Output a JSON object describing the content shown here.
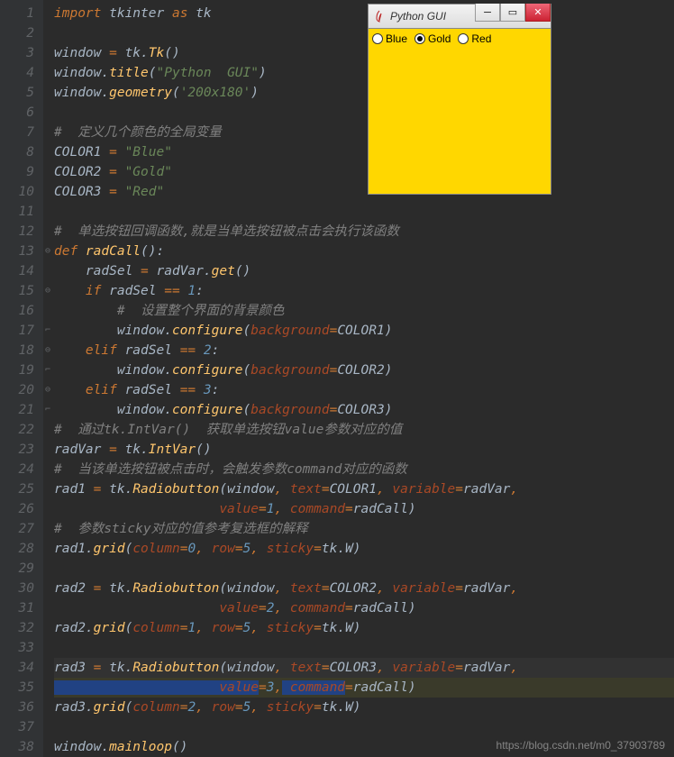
{
  "gutter": [
    "1",
    "2",
    "3",
    "4",
    "5",
    "6",
    "7",
    "8",
    "9",
    "10",
    "11",
    "12",
    "13",
    "14",
    "15",
    "16",
    "17",
    "18",
    "19",
    "20",
    "21",
    "22",
    "23",
    "24",
    "25",
    "26",
    "27",
    "28",
    "29",
    "30",
    "31",
    "32",
    "33",
    "34",
    "35",
    "36",
    "37",
    "38"
  ],
  "gui": {
    "title": "Python GUI",
    "radios": {
      "blue": "Blue",
      "gold": "Gold",
      "red": "Red"
    },
    "selected": "gold"
  },
  "watermark": "https://blog.csdn.net/m0_37903789",
  "code": {
    "l1_import": "import",
    "l1_tkinter": " tkinter ",
    "l1_as": "as",
    "l1_tk": " tk",
    "l3_window": "window ",
    "l3_eq": "=",
    "l3_tktk": " tk.",
    "l3_Tk": "Tk",
    "l3_par": "()",
    "l4_window": "window.",
    "l4_title": "title",
    "l4_open": "(",
    "l4_str": "\"Python  GUI\"",
    "l4_close": ")",
    "l5_window": "window.",
    "l5_geom": "geometry",
    "l5_open": "(",
    "l5_str": "'200x180'",
    "l5_close": ")",
    "l7_com": "#  定义几个颜色的全局变量",
    "l8_var": "COLOR1 ",
    "l8_eq": "=",
    "l8_str": " \"Blue\"",
    "l9_var": "COLOR2 ",
    "l9_eq": "=",
    "l9_str": " \"Gold\"",
    "l10_var": "COLOR3 ",
    "l10_eq": "=",
    "l10_str": " \"Red\"",
    "l12_com": "#  单选按钮回调函数,就是当单选按钮被点击会执行该函数",
    "l13_def": "def ",
    "l13_fn": "radCall",
    "l13_par": "():",
    "l14_var": "    radSel ",
    "l14_eq": "=",
    "l14_radvar": " radVar.",
    "l14_get": "get",
    "l14_par": "()",
    "l15_if": "    if ",
    "l15_var": "radSel ",
    "l15_eq": "==",
    "l15_num": " 1",
    "l15_col": ":",
    "l16_com": "        #  设置整个界面的背景颜色",
    "l17_window": "        window.",
    "l17_conf": "configure",
    "l17_open": "(",
    "l17_bg": "background",
    "l17_eq": "=",
    "l17_c": "COLOR1)",
    "l18_elif": "    elif ",
    "l18_var": "radSel ",
    "l18_eq": "==",
    "l18_num": " 2",
    "l18_col": ":",
    "l19_window": "        window.",
    "l19_conf": "configure",
    "l19_open": "(",
    "l19_bg": "background",
    "l19_eq": "=",
    "l19_c": "COLOR2)",
    "l20_elif": "    elif ",
    "l20_var": "radSel ",
    "l20_eq": "==",
    "l20_num": " 3",
    "l20_col": ":",
    "l21_window": "        window.",
    "l21_conf": "configure",
    "l21_open": "(",
    "l21_bg": "background",
    "l21_eq": "=",
    "l21_c": "COLOR3)",
    "l22_com": "#  通过tk.IntVar()  获取单选按钮value参数对应的值",
    "l23_var": "radVar ",
    "l23_eq": "=",
    "l23_tk": " tk.",
    "l23_intvar": "IntVar",
    "l23_par": "()",
    "l24_com": "#  当该单选按钮被点击时，会触发参数command对应的函数",
    "l25_var": "rad1 ",
    "l25_eq": "=",
    "l25_tk": " tk.",
    "l25_rb": "Radiobutton",
    "l25_open": "(window",
    "l25_c": ",",
    "l25_text": " text",
    "l25_teq": "=",
    "l25_col": "COLOR1",
    "l25_c2": ",",
    "l25_variable": " variable",
    "l25_veq": "=",
    "l25_rv": "radVar",
    "l25_c3": ",",
    "l26_value": "                     value",
    "l26_eq": "=",
    "l26_num": "1",
    "l26_c": ",",
    "l26_cmd": " command",
    "l26_ceq": "=",
    "l26_rc": "radCall)",
    "l27_com": "#  参数sticky对应的值参考复选框的解释",
    "l28_var": "rad1.",
    "l28_grid": "grid",
    "l28_open": "(",
    "l28_col": "column",
    "l28_eq": "=",
    "l28_n0": "0",
    "l28_c": ",",
    "l28_row": " row",
    "l28_req": "=",
    "l28_n5": "5",
    "l28_c2": ",",
    "l28_st": " sticky",
    "l28_seq": "=",
    "l28_tkw": "tk.W)",
    "l30_var": "rad2 ",
    "l30_eq": "=",
    "l30_tk": " tk.",
    "l30_rb": "Radiobutton",
    "l30_open": "(window",
    "l30_c": ",",
    "l30_text": " text",
    "l30_teq": "=",
    "l30_col": "COLOR2",
    "l30_c2": ",",
    "l30_variable": " variable",
    "l30_veq": "=",
    "l30_rv": "radVar",
    "l30_c3": ",",
    "l31_value": "                     value",
    "l31_eq": "=",
    "l31_num": "2",
    "l31_c": ",",
    "l31_cmd": " command",
    "l31_ceq": "=",
    "l31_rc": "radCall)",
    "l32_var": "rad2.",
    "l32_grid": "grid",
    "l32_open": "(",
    "l32_col": "column",
    "l32_eq": "=",
    "l32_n1": "1",
    "l32_c": ",",
    "l32_row": " row",
    "l32_req": "=",
    "l32_n5": "5",
    "l32_c2": ",",
    "l32_st": " sticky",
    "l32_seq": "=",
    "l32_tkw": "tk.W)",
    "l34_var": "rad3 ",
    "l34_eq": "=",
    "l34_tk": " tk.",
    "l34_rb": "Radiobutton",
    "l34_open": "(window",
    "l34_c": ",",
    "l34_text": " text",
    "l34_teq": "=",
    "l34_col": "COLOR3",
    "l34_c2": ",",
    "l34_variable": " variable",
    "l34_veq": "=",
    "l34_rv": "radVar",
    "l34_c3": ",",
    "l35_value": "                     value",
    "l35_eq": "=",
    "l35_num": "3",
    "l35_c": ",",
    "l35_cmd": " command",
    "l35_ceq": "=",
    "l35_rc": "radCall)",
    "l36_var": "rad3.",
    "l36_grid": "grid",
    "l36_open": "(",
    "l36_col": "column",
    "l36_eq": "=",
    "l36_n2": "2",
    "l36_c": ",",
    "l36_row": " row",
    "l36_req": "=",
    "l36_n5": "5",
    "l36_c2": ",",
    "l36_st": " sticky",
    "l36_seq": "=",
    "l36_tkw": "tk.W)",
    "l38_window": "window.",
    "l38_ml": "mainloop",
    "l38_par": "()"
  }
}
